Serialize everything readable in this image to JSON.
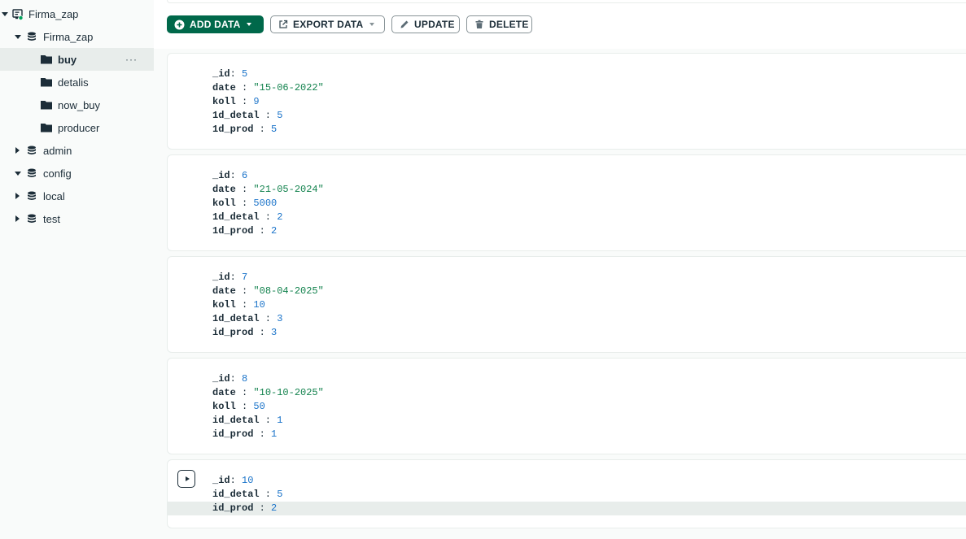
{
  "sidebar": {
    "connection": {
      "label": "Firma_zap",
      "icon": "connection-icon",
      "status_color": "#00a35c"
    },
    "databases": [
      {
        "label": "Firma_zap",
        "expanded": true,
        "collections": [
          {
            "label": "buy",
            "selected": true,
            "more": "···"
          },
          {
            "label": "detalis"
          },
          {
            "label": "now_buy"
          },
          {
            "label": "producer"
          }
        ]
      },
      {
        "label": "admin",
        "expanded": false
      },
      {
        "label": "config",
        "expanded": true
      },
      {
        "label": "local",
        "expanded": false
      },
      {
        "label": "test",
        "expanded": false
      }
    ]
  },
  "toolbar": {
    "add_data": "ADD DATA",
    "export_data": "EXPORT DATA",
    "update": "UPDATE",
    "delete": "DELETE"
  },
  "documents": [
    {
      "fields": [
        {
          "key": "_id",
          "value": "5",
          "type": "number"
        },
        {
          "key": "date",
          "value": "\"15-06-2022\"",
          "type": "string"
        },
        {
          "key": "koll",
          "value": "9",
          "type": "number"
        },
        {
          "key": "1d_detal",
          "value": "5",
          "type": "number"
        },
        {
          "key": "1d_prod",
          "value": "5",
          "type": "number"
        }
      ]
    },
    {
      "fields": [
        {
          "key": "_id",
          "value": "6",
          "type": "number"
        },
        {
          "key": "date",
          "value": "\"21-05-2024\"",
          "type": "string"
        },
        {
          "key": "koll",
          "value": "5000",
          "type": "number"
        },
        {
          "key": "1d_detal",
          "value": "2",
          "type": "number"
        },
        {
          "key": "1d_prod",
          "value": "2",
          "type": "number"
        }
      ]
    },
    {
      "fields": [
        {
          "key": "_id",
          "value": "7",
          "type": "number"
        },
        {
          "key": "date",
          "value": "\"08-04-2025\"",
          "type": "string"
        },
        {
          "key": "koll",
          "value": "10",
          "type": "number"
        },
        {
          "key": "1d_detal",
          "value": "3",
          "type": "number"
        },
        {
          "key": "id_prod",
          "value": "3",
          "type": "number"
        }
      ]
    },
    {
      "fields": [
        {
          "key": "_id",
          "value": "8",
          "type": "number"
        },
        {
          "key": "date",
          "value": "\"10-10-2025\"",
          "type": "string"
        },
        {
          "key": "koll",
          "value": "50",
          "type": "number"
        },
        {
          "key": "id_detal",
          "value": "1",
          "type": "number"
        },
        {
          "key": "id_prod",
          "value": "1",
          "type": "number"
        }
      ]
    },
    {
      "has_expand": true,
      "fields": [
        {
          "key": "_id",
          "value": "10",
          "type": "number"
        },
        {
          "key": "id_detal",
          "value": "5",
          "type": "number"
        },
        {
          "key": "id_prod",
          "value": "2",
          "type": "number",
          "highlighted": true
        }
      ]
    }
  ],
  "colors": {
    "primary": "#00684a",
    "string_value": "#12824d",
    "number_value": "#1a73c9",
    "text": "#1c2d38"
  }
}
